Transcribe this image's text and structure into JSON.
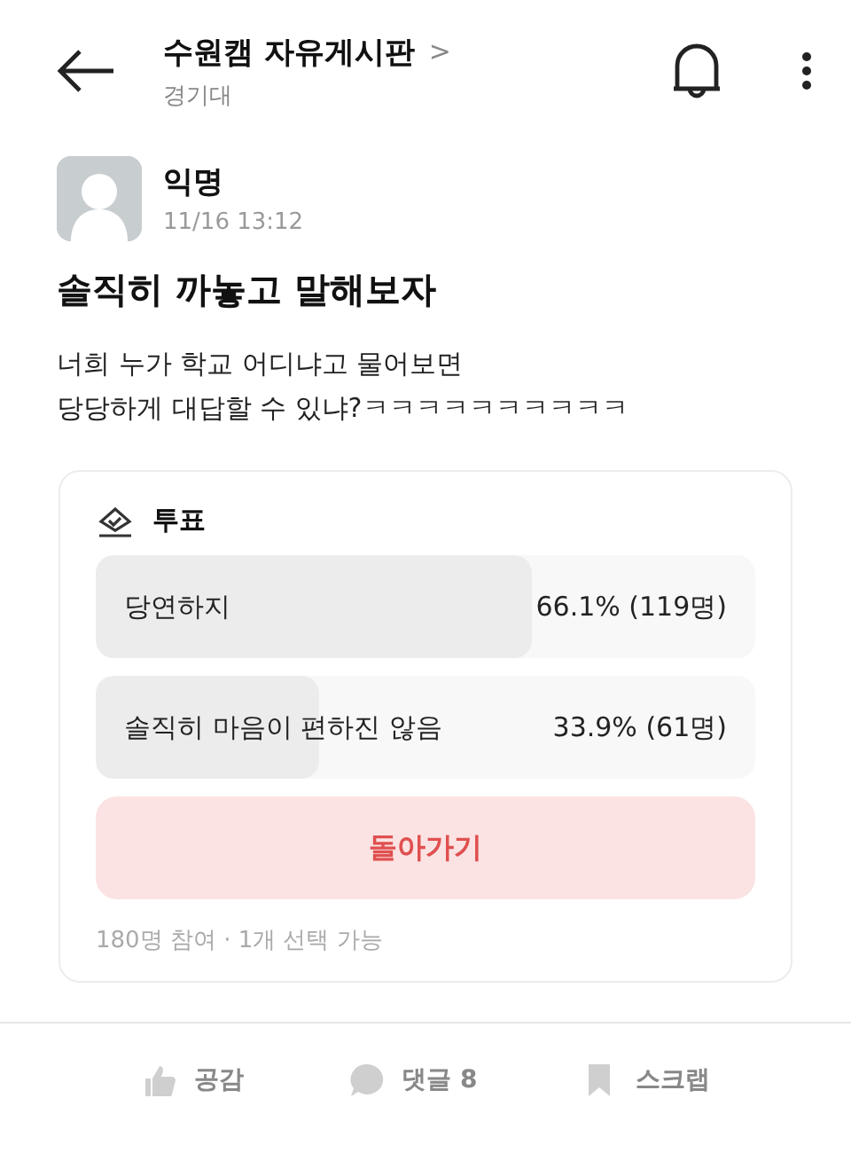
{
  "header": {
    "title": "수원캠 자유게시판",
    "chevron": ">",
    "subtitle": "경기대"
  },
  "post": {
    "author": "익명",
    "time": "11/16 13:12",
    "title": "솔직히 까놓고 말해보자",
    "body": [
      "너희 누가 학교 어디냐고 물어보면",
      "당당하게 대답할 수 있냐?ㅋㅋㅋㅋㅋㅋㅋㅋㅋㅋ"
    ]
  },
  "poll": {
    "title": "투표",
    "options": [
      {
        "label": "당연하지",
        "reading": "66.1% (119명)",
        "level": 0.661
      },
      {
        "label": "솔직히 마음이 편하진 않음",
        "reading": "33.9% (61명)",
        "level": 0.339
      }
    ],
    "button": "돌아가기",
    "footer": "180명 참여 · 1개 선택 가능"
  },
  "actions": [
    {
      "kind": "like",
      "label": "공감"
    },
    {
      "kind": "comment",
      "label": "댓글 8"
    },
    {
      "kind": "scrap",
      "label": "스크랩"
    }
  ]
}
